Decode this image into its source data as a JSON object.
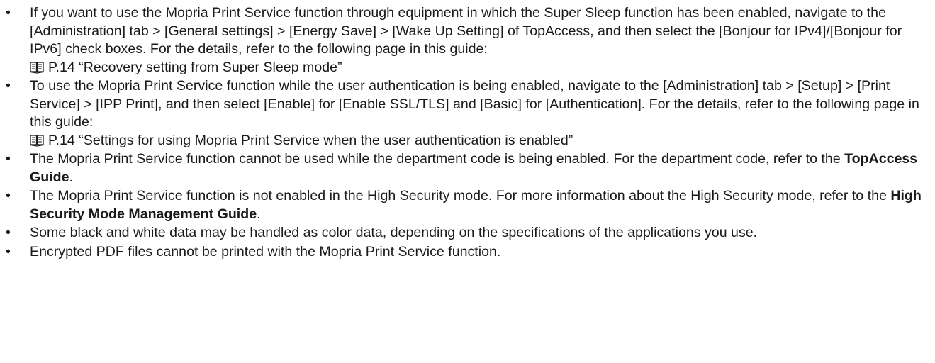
{
  "notes": [
    {
      "text": "If you want to use the Mopria Print Service function through equipment in which the Super Sleep function has been enabled, navigate to the [Administration] tab > [General settings] > [Energy Save] > [Wake Up Setting] of TopAccess, and then select the [Bonjour for IPv4]/[Bonjour for IPv6] check boxes. For the details, refer to the following page in this guide:",
      "ref_icon": "book-icon",
      "ref": "P.14 “Recovery setting from Super Sleep mode”"
    },
    {
      "text": "To use the Mopria Print Service function while the user authentication is being enabled, navigate to the [Administration] tab > [Setup] > [Print Service] > [IPP Print], and then select [Enable] for [Enable SSL/TLS] and [Basic] for [Authentication]. For the details, refer to the following page in this guide:",
      "ref_icon": "book-icon",
      "ref": "P.14 “Settings for using Mopria Print Service when the user authentication is enabled”"
    },
    {
      "text_before": "The Mopria Print Service function cannot be used while the department code is being enabled. For the department code, refer to the ",
      "bold": "TopAccess Guide",
      "text_after": "."
    },
    {
      "text_before": "The Mopria Print Service function is not enabled in the High Security mode. For more information about the High Security mode, refer to the ",
      "bold": "High Security Mode Management Guide",
      "text_after": "."
    },
    {
      "text": "Some black and white data may be handled as color data, depending on the specifications of the applications you use."
    },
    {
      "text": "Encrypted PDF files cannot be printed with the Mopria Print Service function."
    }
  ],
  "bullet_char": "•"
}
